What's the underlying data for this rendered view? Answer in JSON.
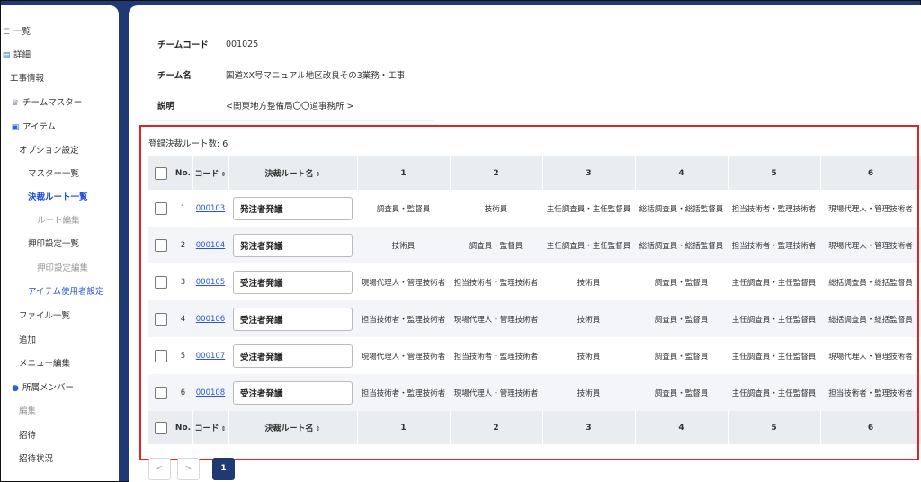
{
  "sidebar": {
    "items": [
      {
        "label": "一覧",
        "icon": "list-icon"
      },
      {
        "label": "詳細",
        "icon": "document-icon"
      },
      {
        "label": "工事情報"
      },
      {
        "label": "チームマスター",
        "icon": "crown-icon"
      },
      {
        "label": "アイテム",
        "icon": "item-icon"
      },
      {
        "label": "オプション設定"
      },
      {
        "label": "マスター一覧"
      },
      {
        "label": "決裁ルート一覧"
      },
      {
        "label": "ルート編集"
      },
      {
        "label": "押印設定一覧"
      },
      {
        "label": "押印設定編集"
      },
      {
        "label": "アイテム使用者設定"
      },
      {
        "label": "ファイル一覧"
      },
      {
        "label": "追加"
      },
      {
        "label": "メニュー編集"
      },
      {
        "label": "所属メンバー",
        "icon": "user-icon"
      },
      {
        "label": "編集"
      },
      {
        "label": "招待"
      },
      {
        "label": "招待状況"
      }
    ]
  },
  "info": {
    "rows": [
      {
        "key": "チームコード",
        "value": "001025"
      },
      {
        "key": "チーム名",
        "value": "国道XX号マニュアル地区改良その3業務・工事"
      },
      {
        "key": "説明",
        "value": "<関東地方整備局〇〇道事務所 >"
      }
    ]
  },
  "route_count": "登録決裁ルート数: 6",
  "table": {
    "headers": {
      "no": "No.",
      "code": "コード",
      "name": "決裁ルート名",
      "cols": [
        "1",
        "2",
        "3",
        "4",
        "5",
        "6"
      ]
    },
    "sort_icon": "⇕",
    "rows": [
      {
        "no": "1",
        "code": "000103",
        "name": "発注者発議",
        "cells": [
          "調査員・監督員",
          "技術員",
          "主任調査員・主任監督員",
          "総括調査員・総括監督員",
          "担当技術者・監理技術者",
          "現場代理人・管理技術者"
        ]
      },
      {
        "no": "2",
        "code": "000104",
        "name": "発注者発議",
        "cells": [
          "技術員",
          "調査員・監督員",
          "主任調査員・主任監督員",
          "総括調査員・総括監督員",
          "担当技術者・監理技術者",
          "現場代理人・管理技術者"
        ]
      },
      {
        "no": "3",
        "code": "000105",
        "name": "受注者発議",
        "cells": [
          "現場代理人・管理技術者",
          "担当技術者・監理技術者",
          "技術員",
          "調査員・監督員",
          "主任調査員・主任監督員",
          "総括調査員・総括監督員"
        ]
      },
      {
        "no": "4",
        "code": "000106",
        "name": "受注者発議",
        "cells": [
          "担当技術者・監理技術者",
          "現場代理人・管理技術者",
          "技術員",
          "調査員・監督員",
          "主任調査員・主任監督員",
          "総括調査員・総括監督員"
        ]
      },
      {
        "no": "5",
        "code": "000107",
        "name": "受注者発議",
        "cells": [
          "現場代理人・管理技術者",
          "担当技術者・監理技術者",
          "技術員",
          "調査員・監督員",
          "主任調査員・主任監督員",
          "現場代理人・管理技術者"
        ]
      },
      {
        "no": "6",
        "code": "000108",
        "name": "受注者発議",
        "cells": [
          "担当技術者・監理技術者",
          "現場代理人・管理技術者",
          "技術員",
          "調査員・監督員",
          "主任調査員・主任監督員",
          "担当技術者・監理技術者"
        ]
      }
    ]
  },
  "pager": {
    "prev": "<",
    "next": ">",
    "current": "1"
  },
  "colors": {
    "accent": "#1f3a72",
    "link": "#2a56d6",
    "highlight": "#e02424"
  }
}
